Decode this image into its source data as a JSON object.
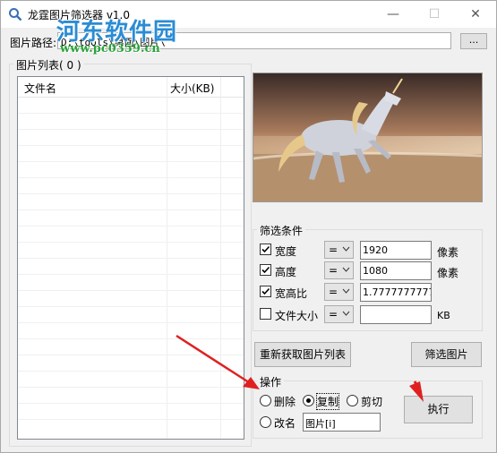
{
  "window": {
    "title": "龙霆图片筛选器 v1.0",
    "controls": {
      "minimize": "—",
      "maximize": "☐",
      "close": "✕"
    }
  },
  "watermark": {
    "name": "河东软件园",
    "url": "www.pc0359.cn"
  },
  "path": {
    "label": "图片路径:",
    "value": "D:\\tools\\桌面\\图片\\",
    "browse_label": "..."
  },
  "file_list": {
    "title": "图片列表( 0 )",
    "columns": [
      "文件名",
      "大小(KB)"
    ],
    "rows": []
  },
  "preview": {
    "description_icon": "unicorn-horse-image"
  },
  "filters": {
    "title": "筛选条件",
    "items": [
      {
        "label": "宽度",
        "checked": true,
        "op": "=",
        "value": "1920",
        "unit": "像素"
      },
      {
        "label": "高度",
        "checked": true,
        "op": "=",
        "value": "1080",
        "unit": "像素"
      },
      {
        "label": "宽高比",
        "checked": true,
        "op": "=",
        "value": "1.7777777777",
        "unit": ""
      },
      {
        "label": "文件大小",
        "checked": false,
        "op": "=",
        "value": "",
        "unit": "KB"
      }
    ]
  },
  "buttons": {
    "refresh": "重新获取图片列表",
    "filter": "筛选图片",
    "execute": "执行"
  },
  "operations": {
    "title": "操作",
    "options": [
      {
        "label": "删除",
        "selected": false
      },
      {
        "label": "复制",
        "selected": true
      },
      {
        "label": "剪切",
        "selected": false
      },
      {
        "label": "改名",
        "selected": false
      }
    ],
    "rename_pattern": "图片[i]"
  },
  "colors": {
    "watermark_blue": "#2a8cd4",
    "watermark_green": "#2aa33a",
    "arrow_red": "#e02020"
  }
}
